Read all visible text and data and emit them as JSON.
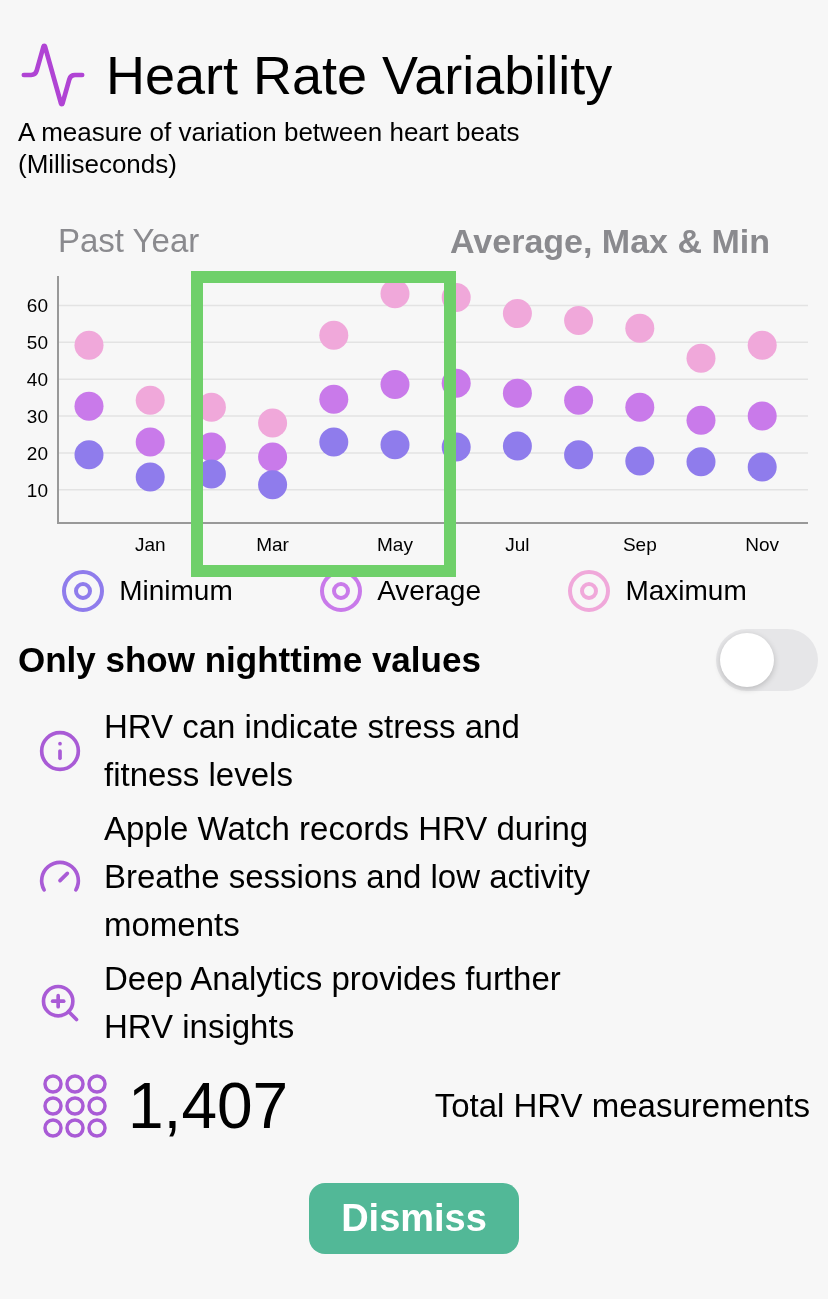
{
  "header": {
    "title": "Heart Rate Variability",
    "subtitle": "A measure of variation between heart beats (Milliseconds)"
  },
  "chart": {
    "period": "Past Year",
    "mode": "Average, Max & Min",
    "chart_data": {
      "type": "scatter",
      "categories": [
        null,
        "Jan",
        null,
        "Mar",
        null,
        "May",
        null,
        "Jul",
        null,
        "Sep",
        null,
        "Nov"
      ],
      "grid": true,
      "ylim": [
        1,
        68
      ],
      "yticks": [
        10,
        20,
        30,
        40,
        50,
        60
      ],
      "series": [
        {
          "name": "Minimum",
          "color": "#8f7cec",
          "values": [
            19.5,
            13.5,
            14.3,
            11.4,
            23,
            22.2,
            21.6,
            21.9,
            19.5,
            17.8,
            17.6,
            16.2
          ]
        },
        {
          "name": "Average",
          "color": "#c97aea",
          "values": [
            32.7,
            23,
            21.6,
            18.9,
            34.6,
            38.6,
            38.9,
            36.2,
            34.3,
            32.4,
            28.9,
            30
          ]
        },
        {
          "name": "Maximum",
          "color": "#f0a8da",
          "values": [
            49.2,
            34.3,
            32.4,
            28.1,
            51.9,
            63.2,
            62.2,
            57.8,
            55.9,
            53.8,
            45.7,
            49.2
          ]
        }
      ]
    }
  },
  "nighttime_toggle": {
    "label": "Only show nighttime values",
    "on": false
  },
  "facts": [
    {
      "kind": "info",
      "text": "HRV can indicate stress and fitness levels"
    },
    {
      "kind": "gauge",
      "text": "Apple Watch records HRV during Breathe sessions and low activity moments"
    },
    {
      "kind": "zoom",
      "text": "Deep Analytics provides further HRV insights"
    }
  ],
  "total": {
    "count": "1,407",
    "label": "Total HRV measurements"
  },
  "dismiss_button": "Dismiss"
}
